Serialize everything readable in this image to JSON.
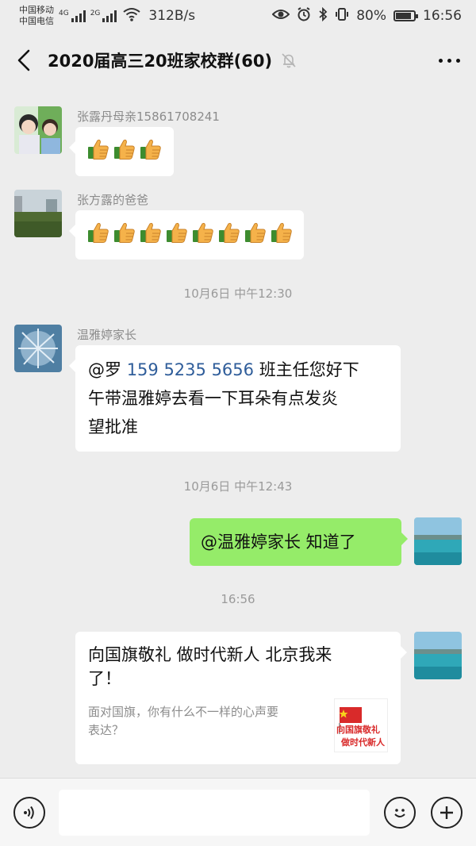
{
  "status_bar": {
    "carrier_1": "中国移动",
    "carrier_2": "中国电信",
    "net_1": "4G",
    "net_2": "2G",
    "speed": "312B/s",
    "battery": "80%",
    "time": "16:56"
  },
  "header": {
    "title": "2020届高三20班家校群(60)"
  },
  "messages": {
    "m1": {
      "sender": "张露丹母亲15861708241",
      "thumb_count": 3
    },
    "m2": {
      "sender": "张方露的爸爸",
      "thumb_count": 8
    },
    "t1": "10月6日 中午12:30",
    "m3": {
      "sender": "温雅婷家长",
      "line1_prefix": "@罗 ",
      "phone": "159 5235 5656",
      "line1_suffix": " 班主任您好下",
      "line2": "午带温雅婷去看一下耳朵有点发炎",
      "line3": "望批准"
    },
    "t2": "10月6日 中午12:43",
    "m4": {
      "text": "@温雅婷家长  知道了"
    },
    "t3": "16:56",
    "m5": {
      "title_line1": "向国旗敬礼 做时代新人 北京我来",
      "title_line2": "了！",
      "desc_line1": "面对国旗，你有什么不一样的心声要",
      "desc_line2": "表达？",
      "thumb_line1": "向国旗敬礼",
      "thumb_line2": "做时代新人"
    }
  },
  "input": {
    "value": "",
    "placeholder": ""
  },
  "colors": {
    "background": "#ededed",
    "sent_bubble": "#95ec69",
    "received_bubble": "#ffffff",
    "phone_link": "#2f5d9a"
  }
}
